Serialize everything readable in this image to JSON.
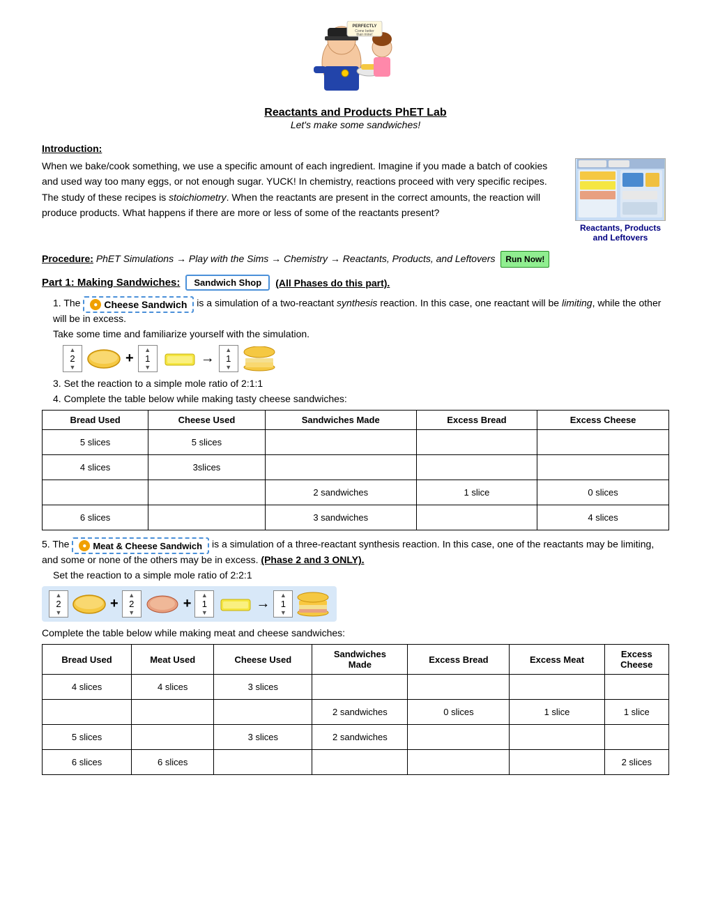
{
  "header": {
    "title": "Reactants and Products PhET Lab",
    "subtitle": "Let's make some sandwiches!"
  },
  "intro": {
    "section_title": "Introduction:",
    "text1": "When we bake/cook something, we use a specific amount of each ingredient.  Imagine if you made a batch of cookies and used way too many eggs, or not enough sugar.  YUCK!  In chemistry, reactions proceed with very specific recipes.  The study of these recipes is stoichiometry.  When the reactants are present in the correct amounts, the reaction will produce products.  What happens if there are more or less of some of the reactants present?",
    "sim_label": "Reactants, Products and Leftovers"
  },
  "procedure": {
    "label": "Procedure:",
    "text": "PhET Simulations → Play with the Sims → Chemistry → Reactants, Products, and Leftovers",
    "run_now": "Run Now!"
  },
  "part1": {
    "header": "Part 1: Making Sandwiches:",
    "shop_btn": "Sandwich Shop",
    "all_phases": "(All Phases do this part).",
    "item1_prefix": "The",
    "cheese_btn": "Cheese Sandwich",
    "item1_suffix": "is a simulation of a two-reactant synthesis reaction.  In this case, one reactant will be limiting, while the other will be in excess.",
    "item2": "Take some time and familiarize yourself with the simulation.",
    "item3_prefix": "Set the reaction to a simple mole ratio of 2:1:1",
    "item4_prefix": "Complete the table below while making tasty cheese sandwiches:",
    "mole_ratio": "2:1:1",
    "table1": {
      "headers": [
        "Bread Used",
        "Cheese Used",
        "Sandwiches Made",
        "Excess Bread",
        "Excess Cheese"
      ],
      "rows": [
        [
          "5 slices",
          "5 slices",
          "",
          "",
          ""
        ],
        [
          "4 slices",
          "3slices",
          "",
          "",
          ""
        ],
        [
          "",
          "",
          "2 sandwiches",
          "1 slice",
          "0 slices"
        ],
        [
          "6 slices",
          "",
          "3 sandwiches",
          "",
          "4 slices"
        ]
      ]
    }
  },
  "part1_item5": {
    "prefix": "The",
    "meat_cheese_btn": "Meat & Cheese Sandwich",
    "suffix": "is a simulation of a three-reactant synthesis reaction.  In this case, one of the reactants may be limiting, and some or none of the others may be in excess.",
    "phase_note": "(Phase 2 and 3 ONLY)."
  },
  "item6": "Set the reaction to a simple mole ratio of 2:2:1",
  "item7": "Complete the table below while making meat and cheese sandwiches:",
  "table2": {
    "headers": [
      "Bread Used",
      "Meat Used",
      "Cheese Used",
      "Sandwiches Made",
      "Excess Bread",
      "Excess Meat",
      "Excess\nCheese"
    ],
    "rows": [
      [
        "4 slices",
        "4 slices",
        "3 slices",
        "",
        "",
        "",
        ""
      ],
      [
        "",
        "",
        "",
        "2 sandwiches",
        "0 slices",
        "1 slice",
        "1 slice"
      ],
      [
        "5 slices",
        "",
        "3 slices",
        "2 sandwiches",
        "",
        "",
        ""
      ],
      [
        "6 slices",
        "6 slices",
        "",
        "",
        "",
        "",
        "2 slices"
      ]
    ]
  },
  "reaction1": {
    "n1": "2",
    "plus1": "+",
    "n2": "1",
    "plus2": "→",
    "n3": "1"
  },
  "reaction2": {
    "n1": "2",
    "plus1": "+",
    "n2": "2",
    "plus2": "+",
    "n3": "1",
    "arrow": "→",
    "n4": "1"
  }
}
